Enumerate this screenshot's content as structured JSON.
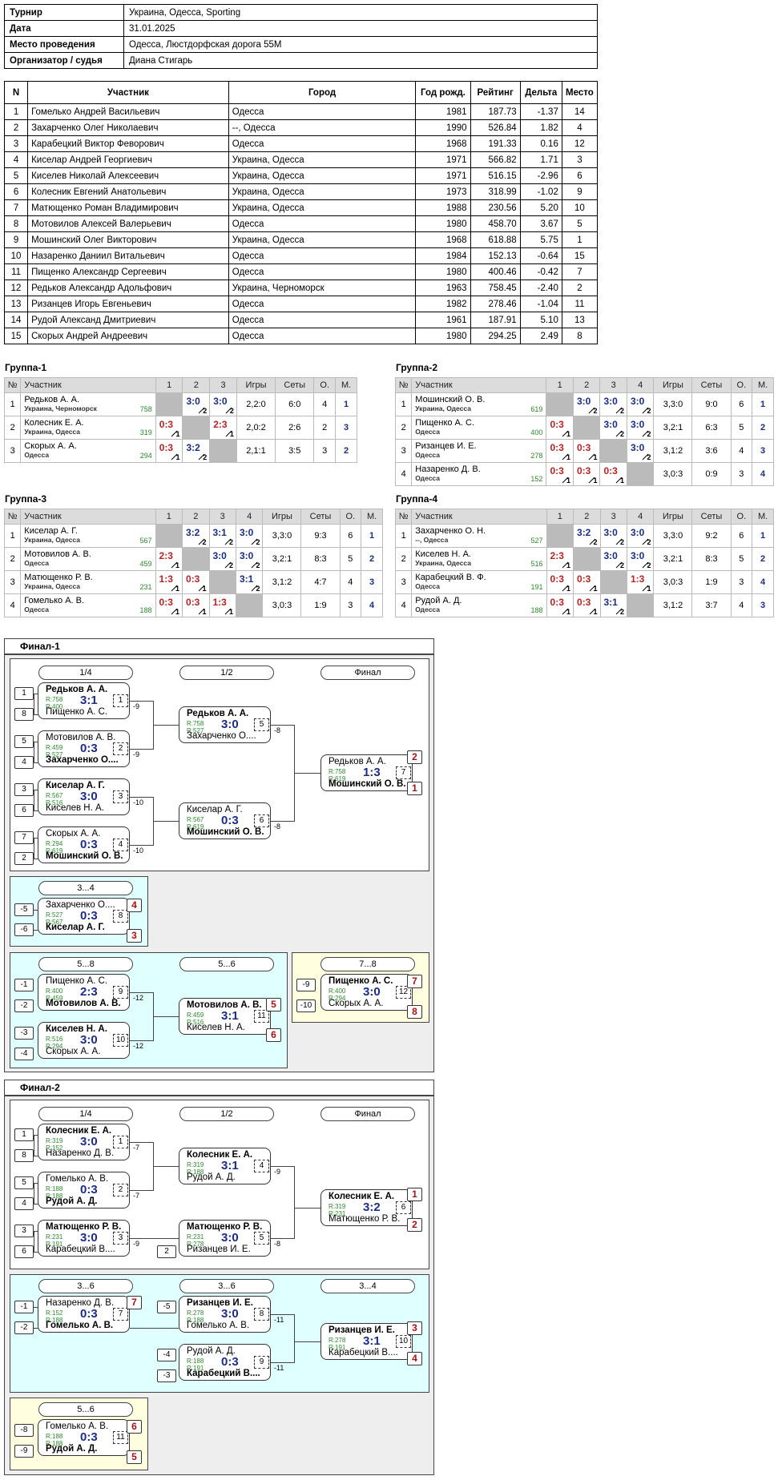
{
  "info": [
    {
      "k": "Турнир",
      "v": "Украина, Одесса, Sporting"
    },
    {
      "k": "Дата",
      "v": "31.01.2025"
    },
    {
      "k": "Место проведения",
      "v": "Одесса, Люстдорфская дорога 55М"
    },
    {
      "k": "Организатор / судья",
      "v": "Диана Стигарь"
    }
  ],
  "players_header": [
    "N",
    "Участник",
    "Город",
    "Год рожд.",
    "Рейтинг",
    "Дельта",
    "Место"
  ],
  "players": [
    [
      "1",
      "Гомелько Андрей Васильевич",
      "Одесса",
      "1981",
      "187.73",
      "-1.37",
      "14"
    ],
    [
      "2",
      "Захарченко Олег Николаевич",
      "--, Одесса",
      "1990",
      "526.84",
      "1.82",
      "4"
    ],
    [
      "3",
      "Карабецкий Виктор Феворович",
      "Одесса",
      "1968",
      "191.33",
      "0.16",
      "12"
    ],
    [
      "4",
      "Киселар Андрей Георгиевич",
      "Украина, Одесса",
      "1971",
      "566.82",
      "1.71",
      "3"
    ],
    [
      "5",
      "Киселев Николай Алексеевич",
      "Украина, Одесса",
      "1971",
      "516.15",
      "-2.96",
      "6"
    ],
    [
      "6",
      "Колесник Евгений Анатольевич",
      "Украина, Одесса",
      "1973",
      "318.99",
      "-1.02",
      "9"
    ],
    [
      "7",
      "Матющенко Роман Владимирович",
      "Украина, Одесса",
      "1988",
      "230.56",
      "5.20",
      "10"
    ],
    [
      "8",
      "Мотовилов Алексей Валерьевич",
      "Одесса",
      "1980",
      "458.70",
      "3.67",
      "5"
    ],
    [
      "9",
      "Мошинский Олег Викторович",
      "Украина, Одесса",
      "1968",
      "618.88",
      "5.75",
      "1"
    ],
    [
      "10",
      "Назаренко Даниил Витальевич",
      "Одесса",
      "1984",
      "152.13",
      "-0.64",
      "15"
    ],
    [
      "11",
      "Пищенко Александр Сергеевич",
      "Одесса",
      "1980",
      "400.46",
      "-0.42",
      "7"
    ],
    [
      "12",
      "Редьков Александр Адольфович",
      "Украина, Черноморск",
      "1963",
      "758.45",
      "-2.40",
      "2"
    ],
    [
      "13",
      "Ризанцев Игорь Евгеньевич",
      "Одесса",
      "1982",
      "278.46",
      "-1.04",
      "11"
    ],
    [
      "14",
      "Рудой Александ Дмитриевич",
      "Одесса",
      "1961",
      "187.91",
      "5.10",
      "13"
    ],
    [
      "15",
      "Скорых Андрей Андреевич",
      "Одесса",
      "1980",
      "294.25",
      "2.49",
      "8"
    ]
  ],
  "group_cols": [
    "№",
    "Участник",
    "Игры",
    "Сеты",
    "О.",
    "М."
  ],
  "groups": [
    {
      "title": "Группа-1",
      "n": 3,
      "rows": [
        {
          "name": "Редьков А. А.",
          "city": "Украина, Черноморск",
          "rating": "758",
          "res": [
            null,
            [
              "3:0",
              "2",
              "w"
            ],
            [
              "3:0",
              "2",
              "w"
            ]
          ],
          "games": "2,2:0",
          "sets": "6:0",
          "pts": "4",
          "place": "1"
        },
        {
          "name": "Колесник Е. А.",
          "city": "Украина, Одесса",
          "rating": "319",
          "res": [
            [
              "0:3",
              "1",
              "l"
            ],
            null,
            [
              "2:3",
              "1",
              "l"
            ]
          ],
          "games": "2,0:2",
          "sets": "2:6",
          "pts": "2",
          "place": "3"
        },
        {
          "name": "Скорых А. А.",
          "city": "Одесса",
          "rating": "294",
          "res": [
            [
              "0:3",
              "1",
              "l"
            ],
            [
              "3:2",
              "2",
              "w"
            ],
            null
          ],
          "games": "2,1:1",
          "sets": "3:5",
          "pts": "3",
          "place": "2"
        }
      ]
    },
    {
      "title": "Группа-2",
      "n": 4,
      "rows": [
        {
          "name": "Мошинский О. В.",
          "city": "Украина, Одесса",
          "rating": "619",
          "res": [
            null,
            [
              "3:0",
              "2",
              "w"
            ],
            [
              "3:0",
              "2",
              "w"
            ],
            [
              "3:0",
              "2",
              "w"
            ]
          ],
          "games": "3,3:0",
          "sets": "9:0",
          "pts": "6",
          "place": "1"
        },
        {
          "name": "Пищенко А. С.",
          "city": "Одесса",
          "rating": "400",
          "res": [
            [
              "0:3",
              "1",
              "l"
            ],
            null,
            [
              "3:0",
              "2",
              "w"
            ],
            [
              "3:0",
              "2",
              "w"
            ]
          ],
          "games": "3,2:1",
          "sets": "6:3",
          "pts": "5",
          "place": "2"
        },
        {
          "name": "Ризанцев И. Е.",
          "city": "Одесса",
          "rating": "278",
          "res": [
            [
              "0:3",
              "1",
              "l"
            ],
            [
              "0:3",
              "1",
              "l"
            ],
            null,
            [
              "3:0",
              "2",
              "w"
            ]
          ],
          "games": "3,1:2",
          "sets": "3:6",
          "pts": "4",
          "place": "3"
        },
        {
          "name": "Назаренко Д. В.",
          "city": "Одесса",
          "rating": "152",
          "res": [
            [
              "0:3",
              "1",
              "l"
            ],
            [
              "0:3",
              "1",
              "l"
            ],
            [
              "0:3",
              "1",
              "l"
            ],
            null
          ],
          "games": "3,0:3",
          "sets": "0:9",
          "pts": "3",
          "place": "4"
        }
      ]
    },
    {
      "title": "Группа-3",
      "n": 4,
      "rows": [
        {
          "name": "Киселар А. Г.",
          "city": "Украина, Одесса",
          "rating": "567",
          "res": [
            null,
            [
              "3:2",
              "2",
              "w"
            ],
            [
              "3:1",
              "2",
              "w"
            ],
            [
              "3:0",
              "2",
              "w"
            ]
          ],
          "games": "3,3:0",
          "sets": "9:3",
          "pts": "6",
          "place": "1"
        },
        {
          "name": "Мотовилов А. В.",
          "city": "Одесса",
          "rating": "459",
          "res": [
            [
              "2:3",
              "1",
              "l"
            ],
            null,
            [
              "3:0",
              "2",
              "w"
            ],
            [
              "3:0",
              "2",
              "w"
            ]
          ],
          "games": "3,2:1",
          "sets": "8:3",
          "pts": "5",
          "place": "2"
        },
        {
          "name": "Матющенко Р. В.",
          "city": "Украина, Одесса",
          "rating": "231",
          "res": [
            [
              "1:3",
              "1",
              "l"
            ],
            [
              "0:3",
              "1",
              "l"
            ],
            null,
            [
              "3:1",
              "2",
              "w"
            ]
          ],
          "games": "3,1:2",
          "sets": "4:7",
          "pts": "4",
          "place": "3"
        },
        {
          "name": "Гомелько А. В.",
          "city": "Одесса",
          "rating": "188",
          "res": [
            [
              "0:3",
              "1",
              "l"
            ],
            [
              "0:3",
              "1",
              "l"
            ],
            [
              "1:3",
              "1",
              "l"
            ],
            null
          ],
          "games": "3,0:3",
          "sets": "1:9",
          "pts": "3",
          "place": "4"
        }
      ]
    },
    {
      "title": "Группа-4",
      "n": 4,
      "rows": [
        {
          "name": "Захарченко О. Н.",
          "city": "--, Одесса",
          "rating": "527",
          "res": [
            null,
            [
              "3:2",
              "2",
              "w"
            ],
            [
              "3:0",
              "2",
              "w"
            ],
            [
              "3:0",
              "2",
              "w"
            ]
          ],
          "games": "3,3:0",
          "sets": "9:2",
          "pts": "6",
          "place": "1"
        },
        {
          "name": "Киселев Н. А.",
          "city": "Украина, Одесса",
          "rating": "516",
          "res": [
            [
              "2:3",
              "1",
              "l"
            ],
            null,
            [
              "3:0",
              "2",
              "w"
            ],
            [
              "3:0",
              "2",
              "w"
            ]
          ],
          "games": "3,2:1",
          "sets": "8:3",
          "pts": "5",
          "place": "2"
        },
        {
          "name": "Карабецкий В. Ф.",
          "city": "Одесса",
          "rating": "191",
          "res": [
            [
              "0:3",
              "1",
              "l"
            ],
            [
              "0:3",
              "1",
              "l"
            ],
            null,
            [
              "1:3",
              "1",
              "l"
            ]
          ],
          "games": "3,0:3",
          "sets": "1:9",
          "pts": "3",
          "place": "4"
        },
        {
          "name": "Рудой А. Д.",
          "city": "Одесса",
          "rating": "188",
          "res": [
            [
              "0:3",
              "1",
              "l"
            ],
            [
              "0:3",
              "1",
              "l"
            ],
            [
              "3:1",
              "2",
              "w"
            ],
            null
          ],
          "games": "3,1:2",
          "sets": "3:7",
          "pts": "4",
          "place": "3"
        }
      ]
    }
  ],
  "final1": {
    "title": "Финал-1",
    "rounds": [
      "1/4",
      "1/2",
      "Финал"
    ],
    "r34": "3...4",
    "r58": "5...8",
    "r56": "5...6",
    "r78": "7...8"
  },
  "final2": {
    "title": "Финал-2",
    "rounds": [
      "1/4",
      "1/2",
      "Финал"
    ],
    "r36": "3...6",
    "r36b": "3...6",
    "r34": "3...4",
    "r56": "5...6"
  },
  "matches": [
    {
      "a": "Редьков А. А.",
      "b": "Пищенко А. С.",
      "ra": "R:758",
      "rb": "R:400",
      "s": "3:1",
      "n": "1",
      "w": "a"
    },
    {
      "a": "Мотовилов А. В.",
      "b": "Захарченко О....",
      "ra": "R:459",
      "rb": "R:527",
      "s": "0:3",
      "n": "2",
      "w": "b"
    },
    {
      "a": "Киселар А. Г.",
      "b": "Киселев Н. А.",
      "ra": "R:567",
      "rb": "R:516",
      "s": "3:0",
      "n": "3",
      "w": "a"
    },
    {
      "a": "Скорых А. А.",
      "b": "Мошинский О. В.",
      "ra": "R:294",
      "rb": "R:619",
      "s": "0:3",
      "n": "4",
      "w": "b"
    },
    {
      "a": "Редьков А. А.",
      "b": "Захарченко О....",
      "ra": "R:758",
      "rb": "R:527",
      "s": "3:0",
      "n": "5",
      "w": "a"
    },
    {
      "a": "Киселар А. Г.",
      "b": "Мошинский О. В.",
      "ra": "R:567",
      "rb": "R:619",
      "s": "0:3",
      "n": "6",
      "w": "b"
    },
    {
      "a": "Редьков А. А.",
      "b": "Мошинский О. В.",
      "ra": "R:758",
      "rb": "R:619",
      "s": "1:3",
      "n": "7",
      "w": "b"
    },
    {
      "a": "Захарченко О....",
      "b": "Киселар А. Г.",
      "ra": "R:527",
      "rb": "R:567",
      "s": "0:3",
      "n": "8",
      "w": "b"
    },
    {
      "a": "Пищенко А. С.",
      "b": "Мотовилов А. В.",
      "ra": "R:400",
      "rb": "R:459",
      "s": "2:3",
      "n": "9",
      "w": "b"
    },
    {
      "a": "Киселев Н. А.",
      "b": "Скорых А. А.",
      "ra": "R:516",
      "rb": "R:294",
      "s": "3:0",
      "n": "10",
      "w": "a"
    },
    {
      "a": "Мотовилов А. В.",
      "b": "Киселев Н. А.",
      "ra": "R:459",
      "rb": "R:516",
      "s": "3:1",
      "n": "11",
      "w": "a"
    },
    {
      "a": "Пищенко А. С.",
      "b": "Скорых А. А.",
      "ra": "R:400",
      "rb": "R:294",
      "s": "3:0",
      "n": "12",
      "w": "a"
    },
    {
      "a": "Колесник Е. А.",
      "b": "Назаренко Д. В.",
      "ra": "R:319",
      "rb": "R:152",
      "s": "3:0",
      "n": "1",
      "w": "a"
    },
    {
      "a": "Гомелько А. В.",
      "b": "Рудой А. Д.",
      "ra": "R:188",
      "rb": "R:188",
      "s": "0:3",
      "n": "2",
      "w": "b"
    },
    {
      "a": "Матющенко Р. В.",
      "b": "Карабецкий В....",
      "ra": "R:231",
      "rb": "R:191",
      "s": "3:0",
      "n": "3",
      "w": "a"
    },
    {
      "a": "Колесник Е. А.",
      "b": "Рудой А. Д.",
      "ra": "R:319",
      "rb": "R:188",
      "s": "3:1",
      "n": "4",
      "w": "a"
    },
    {
      "a": "Матющенко Р. В.",
      "b": "Ризанцев И. Е.",
      "ra": "R:231",
      "rb": "R:278",
      "s": "3:0",
      "n": "5",
      "w": "a"
    },
    {
      "a": "Колесник Е. А.",
      "b": "Матющенко Р. В.",
      "ra": "R:319",
      "rb": "R:231",
      "s": "3:2",
      "n": "6",
      "w": "a"
    },
    {
      "a": "Назаренко Д. В.",
      "b": "Гомелько А. В.",
      "ra": "R:152",
      "rb": "R:188",
      "s": "0:3",
      "n": "7",
      "w": "b"
    },
    {
      "a": "Ризанцев И. Е.",
      "b": "Гомелько А. В.",
      "ra": "R:278",
      "rb": "R:188",
      "s": "3:0",
      "n": "8",
      "w": "a"
    },
    {
      "a": "Рудой А. Д.",
      "b": "Карабецкий В....",
      "ra": "R:188",
      "rb": "R:191",
      "s": "0:3",
      "n": "9",
      "w": "b"
    },
    {
      "a": "Ризанцев И. Е.",
      "b": "Карабецкий В....",
      "ra": "R:278",
      "rb": "R:191",
      "s": "3:1",
      "n": "10",
      "w": "a"
    },
    {
      "a": "Гомелько А. В.",
      "b": "Рудой А. Д.",
      "ra": "R:188",
      "rb": "R:188",
      "s": "0:3",
      "n": "11",
      "w": "b"
    }
  ],
  "seeds": [
    "1",
    "8",
    "5",
    "4",
    "3",
    "6",
    "7",
    "2",
    "-5",
    "-6",
    "-1",
    "-2",
    "-3",
    "-4",
    "-9",
    "-10",
    "1",
    "8",
    "5",
    "4",
    "3",
    "6",
    "2",
    "-1",
    "-2",
    "-5",
    "-4",
    "-3",
    "-8",
    "-9"
  ],
  "losers": [
    "-9",
    "-9",
    "-10",
    "-10",
    "-8",
    "-8",
    "-12",
    "-12",
    "-7",
    "-7",
    "-9",
    "-9",
    "-8",
    "-11",
    "-11"
  ],
  "places": [
    "2",
    "1",
    "4",
    "3",
    "5",
    "6",
    "7",
    "8",
    "1",
    "2",
    "7",
    "3",
    "4",
    "6",
    "5"
  ]
}
